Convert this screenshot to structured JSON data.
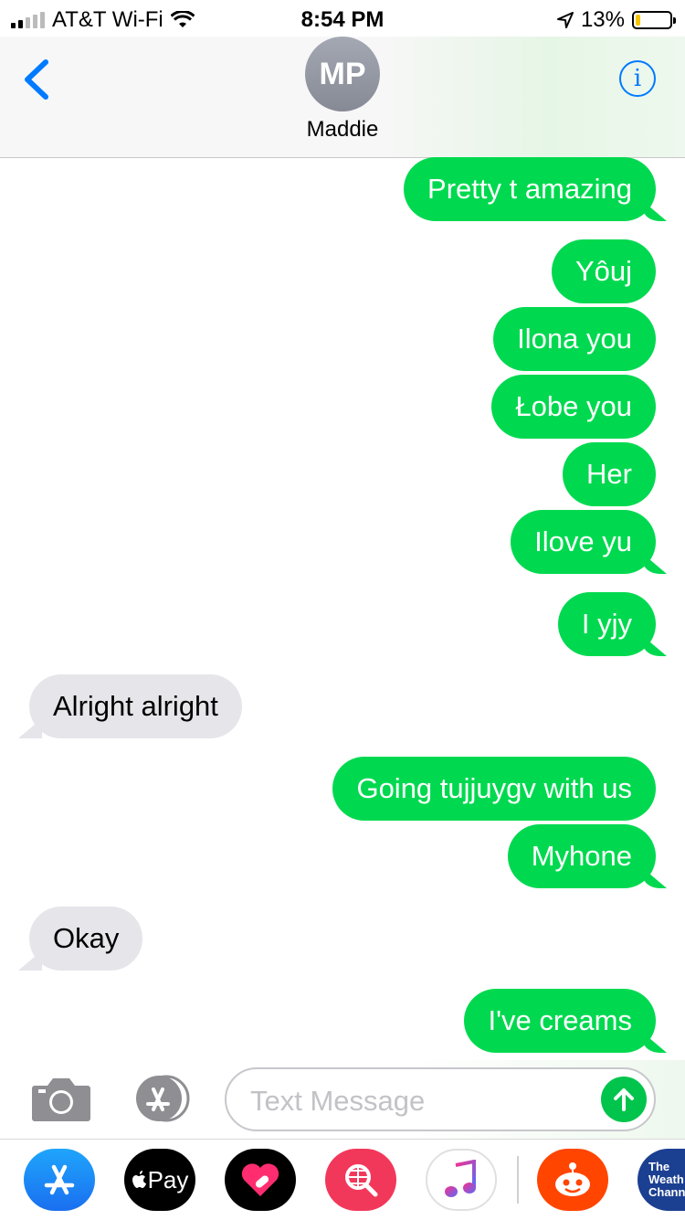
{
  "status_bar": {
    "carrier": "AT&T Wi-Fi",
    "time": "8:54 PM",
    "battery": "13%",
    "battery_level": 0.13
  },
  "header": {
    "avatar_initials": "MP",
    "contact_name": "Maddie"
  },
  "messages": [
    {
      "dir": "out",
      "text": "Pretty t amazing"
    },
    {
      "dir": "out",
      "text": "Yôuj"
    },
    {
      "dir": "out",
      "text": "Ilona you"
    },
    {
      "dir": "out",
      "text": "Łobe you"
    },
    {
      "dir": "out",
      "text": "Her"
    },
    {
      "dir": "out",
      "text": "Ilove yu"
    },
    {
      "dir": "out",
      "text": "I yjy"
    },
    {
      "dir": "in",
      "text": "Alright alright"
    },
    {
      "dir": "out",
      "text": "Going tujjuygv with us"
    },
    {
      "dir": "out",
      "text": "Myhone"
    },
    {
      "dir": "in",
      "text": "Okay"
    },
    {
      "dir": "out",
      "text": "I've creams"
    }
  ],
  "composer": {
    "placeholder": "Text Message",
    "value": ""
  },
  "app_drawer": {
    "apple_pay_label": "Pay",
    "weather_label": "The Weath Chann",
    "apps": [
      "app-store-icon",
      "apple-pay-icon",
      "digital-touch-icon",
      "images-search-icon",
      "music-icon",
      "reddit-icon",
      "weather-channel-icon"
    ]
  },
  "colors": {
    "outgoing_bubble": "#00d94f",
    "incoming_bubble": "#e5e5ea",
    "accent": "#007aff",
    "send_button": "#00c44b"
  }
}
